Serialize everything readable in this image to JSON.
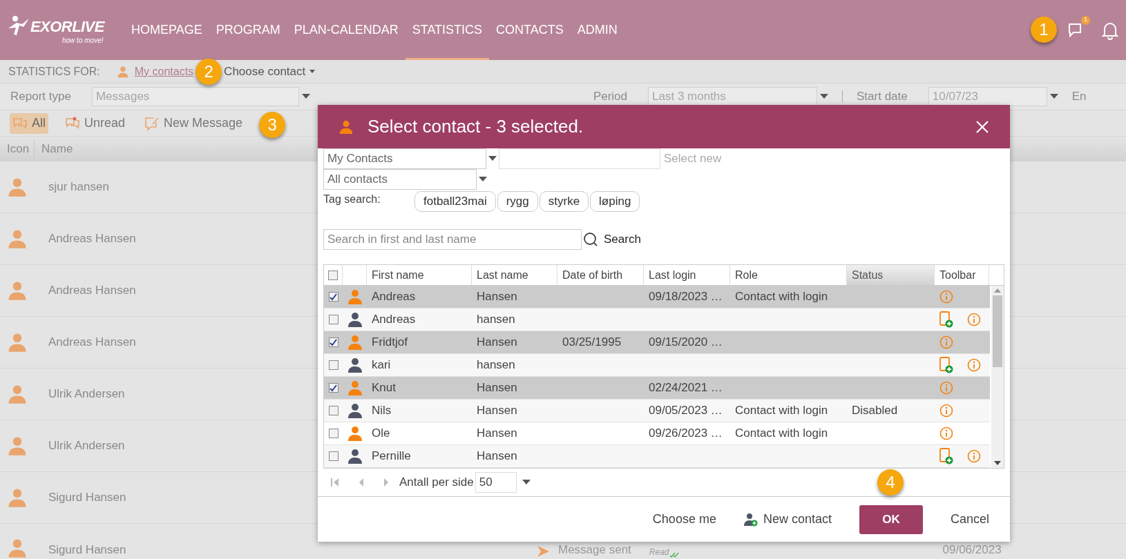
{
  "header": {
    "logo": {
      "name": "EXORLIVE",
      "tagline": "how to move!"
    },
    "nav": [
      {
        "label": "HOMEPAGE",
        "selected": false
      },
      {
        "label": "PROGRAM",
        "selected": false
      },
      {
        "label": "PLAN-CALENDAR",
        "selected": false
      },
      {
        "label": "STATISTICS",
        "selected": true
      },
      {
        "label": "CONTACTS",
        "selected": false
      },
      {
        "label": "ADMIN",
        "selected": false
      }
    ],
    "callout": "1",
    "chat_badge": "1"
  },
  "statistics_for": {
    "label": "STATISTICS FOR:",
    "link": "My contacts",
    "callout": "2",
    "dropdown": "Choose contact"
  },
  "filters": [
    {
      "label": "Report type",
      "value": "Messages"
    },
    {
      "label": "Period",
      "value": "Last 3 months"
    },
    {
      "label": "Start date",
      "value": "10/07/23"
    },
    {
      "label": "En"
    }
  ],
  "message_toolbar": {
    "buttons": [
      {
        "kind": "all",
        "label": "All",
        "selected": true
      },
      {
        "kind": "unread",
        "label": "Unread",
        "selected": false
      },
      {
        "kind": "new",
        "label": "New Message",
        "selected": false
      }
    ],
    "callout": "3"
  },
  "message_list": {
    "columns": [
      "Icon",
      "Name"
    ],
    "rows": [
      {
        "name": "sjur hansen"
      },
      {
        "name": "Andreas Hansen"
      },
      {
        "name": "Andreas Hansen"
      },
      {
        "name": "Andreas Hansen"
      },
      {
        "name": "Ulrik Andersen"
      },
      {
        "name": "Ulrik Andersen"
      },
      {
        "name": "Sigurd Hansen"
      },
      {
        "name": "Sigurd Hansen",
        "message": "Message sent",
        "read": "Read",
        "date": "09/06/2023"
      }
    ]
  },
  "dialog": {
    "title": "Select contact - 3 selected.",
    "select_all": false,
    "contact_list": "My Contacts",
    "select_new": {
      "label": "Select new",
      "disabled": true
    },
    "filter": "All contacts",
    "tag_search_label": "Tag search:",
    "tags": [
      "fotball23mai",
      "rygg",
      "styrke",
      "løping"
    ],
    "search": {
      "placeholder": "Search in first and last name",
      "button": "Search"
    },
    "columns": [
      {
        "label": "First name",
        "hovered": false
      },
      {
        "label": "Last name",
        "hovered": false
      },
      {
        "label": "Date of birth",
        "hovered": false
      },
      {
        "label": "Last login",
        "hovered": false
      },
      {
        "label": "Role",
        "hovered": false
      },
      {
        "label": "Status",
        "hovered": true
      },
      {
        "label": "Toolbar",
        "hovered": false
      }
    ],
    "rows": [
      {
        "checked": true,
        "color": "#f5820f",
        "first": "Andreas",
        "last": "Hansen",
        "last_login": "09/18/2023 …",
        "role": "Contact with login",
        "invite": false
      },
      {
        "checked": false,
        "color": "#4f5566",
        "first": "Andreas",
        "last": "hansen",
        "invite": true
      },
      {
        "checked": true,
        "color": "#f5820f",
        "first": "Fridtjof",
        "last": "Hansen",
        "birth": "03/25/1995",
        "last_login": "09/15/2020 …",
        "invite": false
      },
      {
        "checked": false,
        "color": "#4f5566",
        "first": "kari",
        "last": "hansen",
        "invite": true
      },
      {
        "checked": true,
        "color": "#f5820f",
        "first": "Knut",
        "last": "Hansen",
        "last_login": "02/24/2021 …",
        "invite": false
      },
      {
        "checked": false,
        "color": "#4f5566",
        "first": "Nils",
        "last": "Hansen",
        "last_login": "09/05/2023 …",
        "role": "Contact with login",
        "status": "Disabled",
        "invite": false
      },
      {
        "checked": false,
        "color": "#f5820f",
        "first": "Ole",
        "last": "Hansen",
        "last_login": "09/26/2023 …",
        "role": "Contact with login",
        "invite": false
      },
      {
        "checked": false,
        "color": "#4f5566",
        "first": "Pernille",
        "last": "Hansen",
        "invite": true
      }
    ],
    "pager": {
      "label": "Antall per side",
      "per_page": "50"
    },
    "footer": {
      "choose_me": "Choose me",
      "new_contact": "New contact",
      "ok": "OK",
      "cancel": "Cancel",
      "callout": "4"
    }
  }
}
